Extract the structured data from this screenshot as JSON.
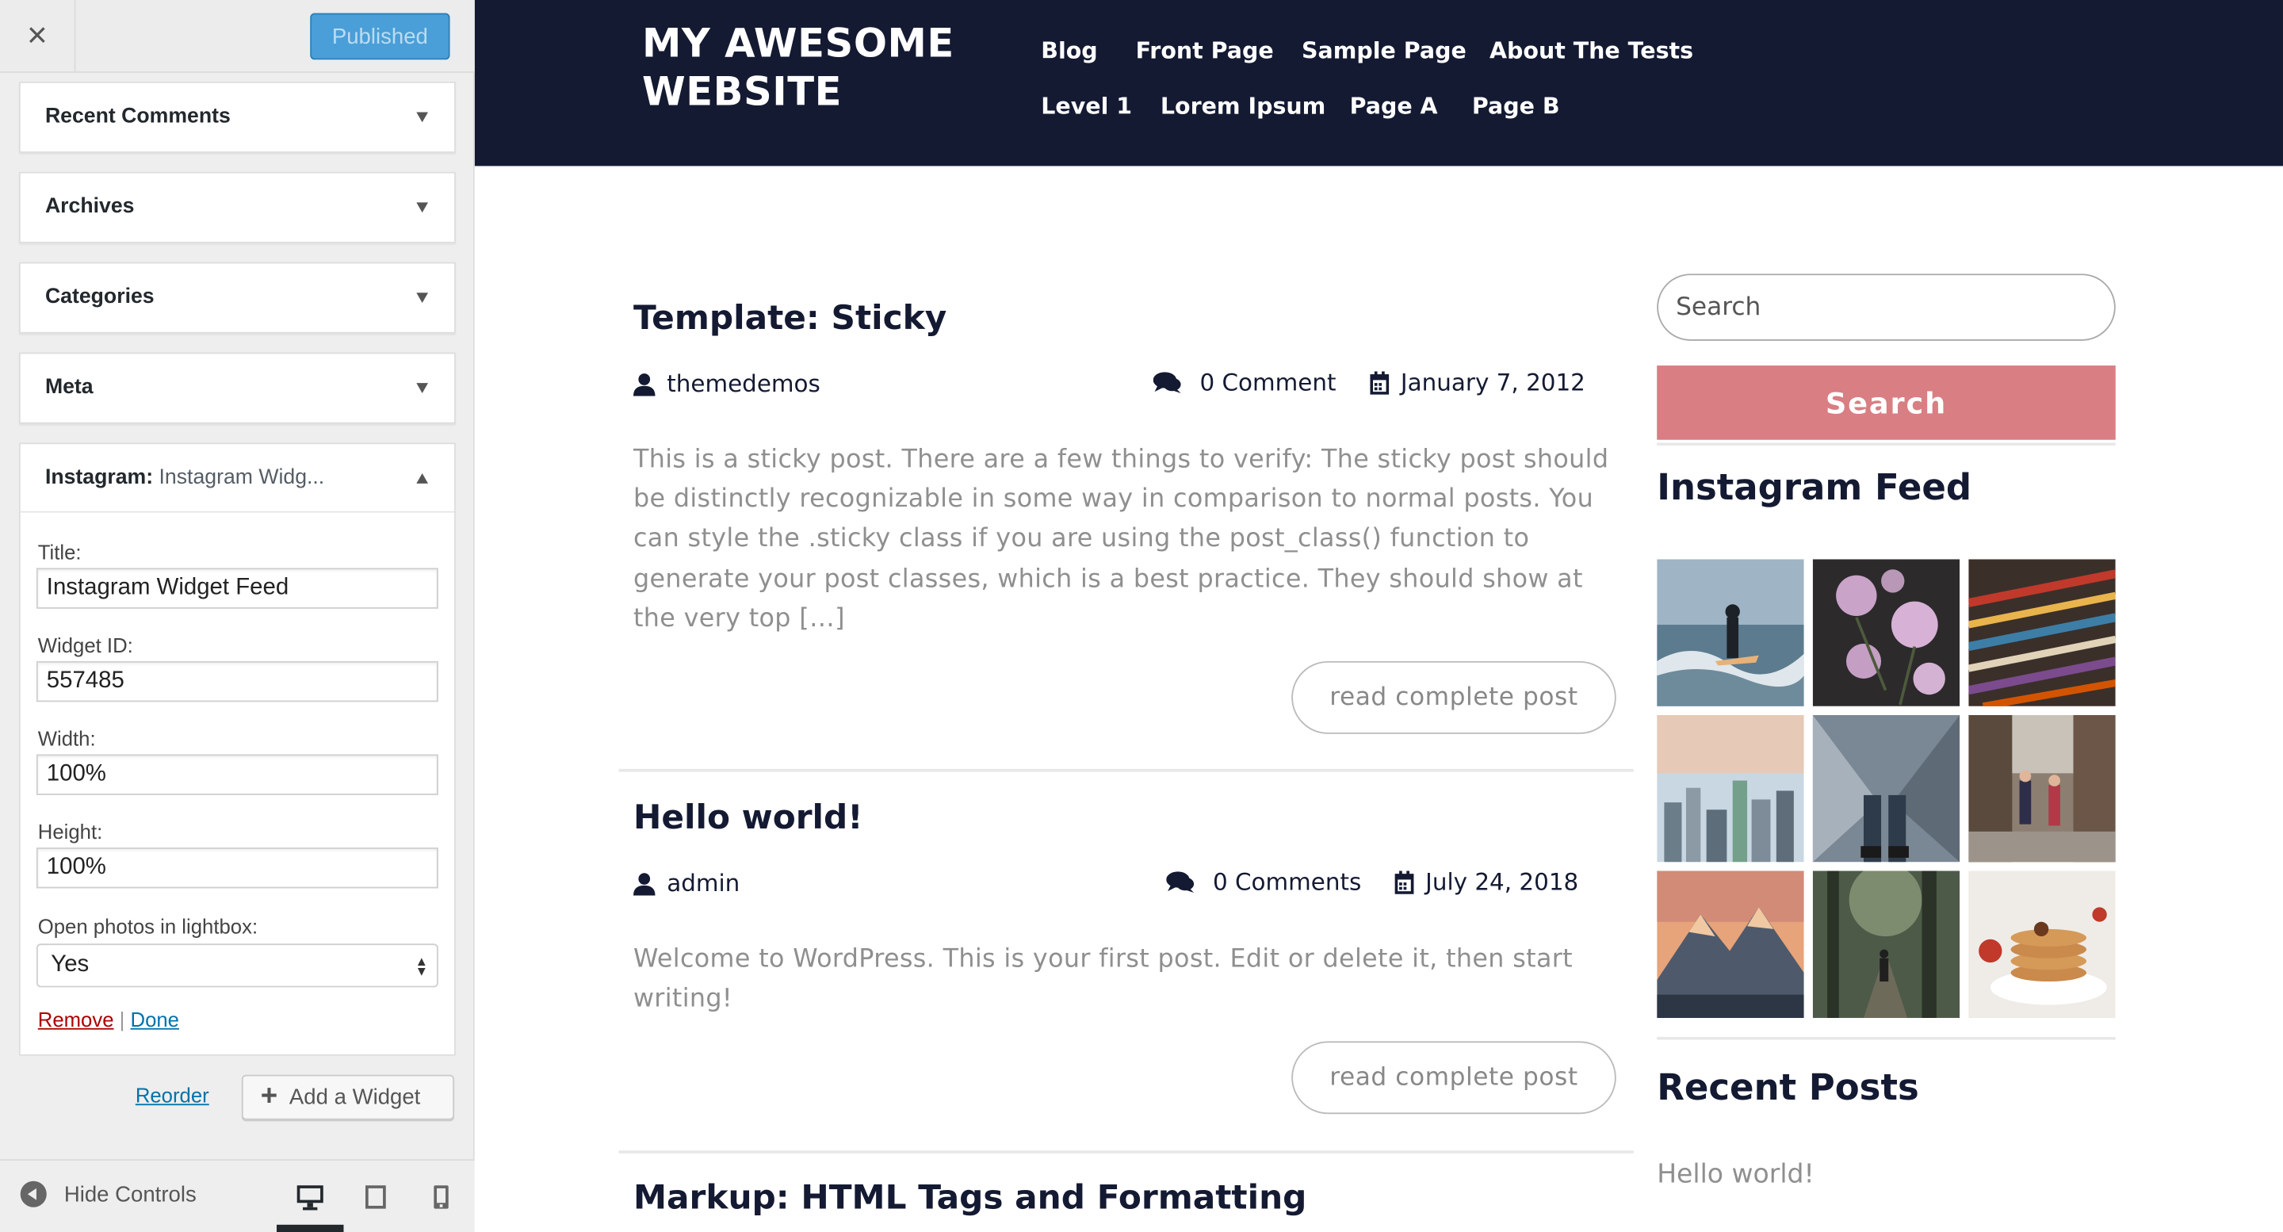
{
  "customizer": {
    "close_label": "×",
    "publish_label": "Published",
    "sections": [
      {
        "label": "Recent Comments"
      },
      {
        "label": "Archives"
      },
      {
        "label": "Categories"
      },
      {
        "label": "Meta"
      }
    ],
    "widget": {
      "header_prefix": "Instagram:",
      "header_title": "Instagram Widg...",
      "title_label": "Title:",
      "title_value": "Instagram Widget Feed",
      "widget_id_label": "Widget ID:",
      "widget_id_value": "557485",
      "width_label": "Width:",
      "width_value": "100%",
      "height_label": "Height:",
      "height_value": "100%",
      "lightbox_label": "Open photos in lightbox:",
      "lightbox_value": "Yes",
      "remove_label": "Remove",
      "separator": "|",
      "done_label": "Done"
    },
    "reorder_label": "Reorder",
    "add_widget_label": "Add a Widget",
    "hide_controls_label": "Hide Controls",
    "active_device": "desktop"
  },
  "site": {
    "title": "MY AWESOME WEBSITE",
    "nav": [
      "Blog",
      "Front Page",
      "Sample Page",
      "About The Tests",
      "Level 1",
      "Lorem Ipsum",
      "Page A",
      "Page B"
    ],
    "posts": [
      {
        "title": "Template: Sticky",
        "author": "themedemos",
        "comments": "0 Comment",
        "date": "January 7, 2012",
        "excerpt": "This is a sticky post. There are a few things to verify: The sticky post should be distinctly recognizable in some way in comparison to normal posts. You can style the .sticky class if you are using the post_class() function to generate your post classes, which is a best practice. They should show at the very top […]",
        "button": "read complete post"
      },
      {
        "title": "Hello world!",
        "author": "admin",
        "comments": "0 Comments",
        "date": "July 24, 2018",
        "excerpt": "Welcome to WordPress. This is your first post. Edit or delete it, then start writing!",
        "button": "read complete post"
      },
      {
        "title": "Markup: HTML Tags and Formatting"
      }
    ],
    "sidebar": {
      "search_placeholder": "Search",
      "search_button": "Search",
      "instagram_title": "Instagram Feed",
      "recent_posts_title": "Recent Posts",
      "recent_posts": [
        "Hello world!"
      ]
    },
    "colors": {
      "header_bg": "#141a32",
      "accent": "#d97e83",
      "publish_button": "#4a9fd8"
    }
  }
}
